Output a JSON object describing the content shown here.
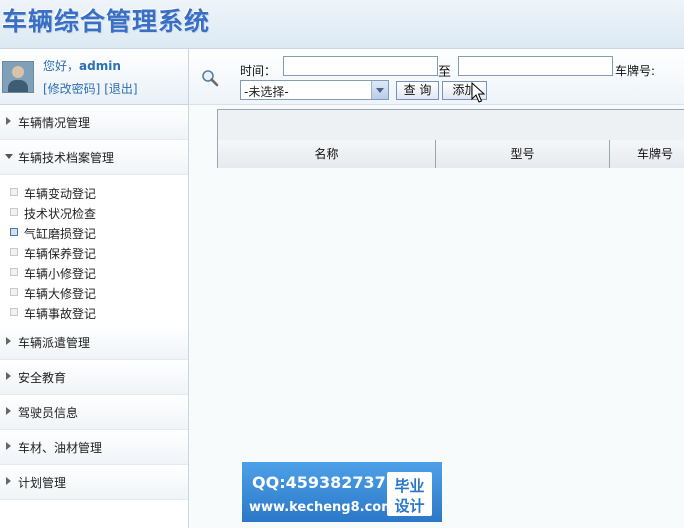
{
  "app": {
    "title": "车辆综合管理系统"
  },
  "user": {
    "greeting_prefix": "您好，",
    "username": "admin",
    "change_password": "[修改密码]",
    "logout": "[退出]"
  },
  "sidebar": {
    "items": [
      {
        "label": "车辆情况管理"
      },
      {
        "label": "车辆技术档案管理"
      },
      {
        "label": "车辆派遣管理"
      },
      {
        "label": "安全教育"
      },
      {
        "label": "驾驶员信息"
      },
      {
        "label": "车材、油材管理"
      },
      {
        "label": "计划管理"
      }
    ],
    "submenu": [
      {
        "label": "车辆变动登记"
      },
      {
        "label": "技术状况检查"
      },
      {
        "label": "气缸磨损登记"
      },
      {
        "label": "车辆保养登记"
      },
      {
        "label": "车辆小修登记"
      },
      {
        "label": "车辆大修登记"
      },
      {
        "label": "车辆事故登记"
      }
    ]
  },
  "search": {
    "time_label": "时间：",
    "time_start": "",
    "to_label": "至",
    "time_end": "",
    "plate_label": "车牌号:",
    "select_value": "-未选择-",
    "query_button": "查 询",
    "add_button": "添加"
  },
  "table": {
    "columns": [
      "名称",
      "型号",
      "车牌号"
    ]
  },
  "watermark": {
    "qq": "QQ:459382737",
    "url": "www.kecheng8.com",
    "badge_line1": "毕业",
    "badge_line2": "设计"
  }
}
